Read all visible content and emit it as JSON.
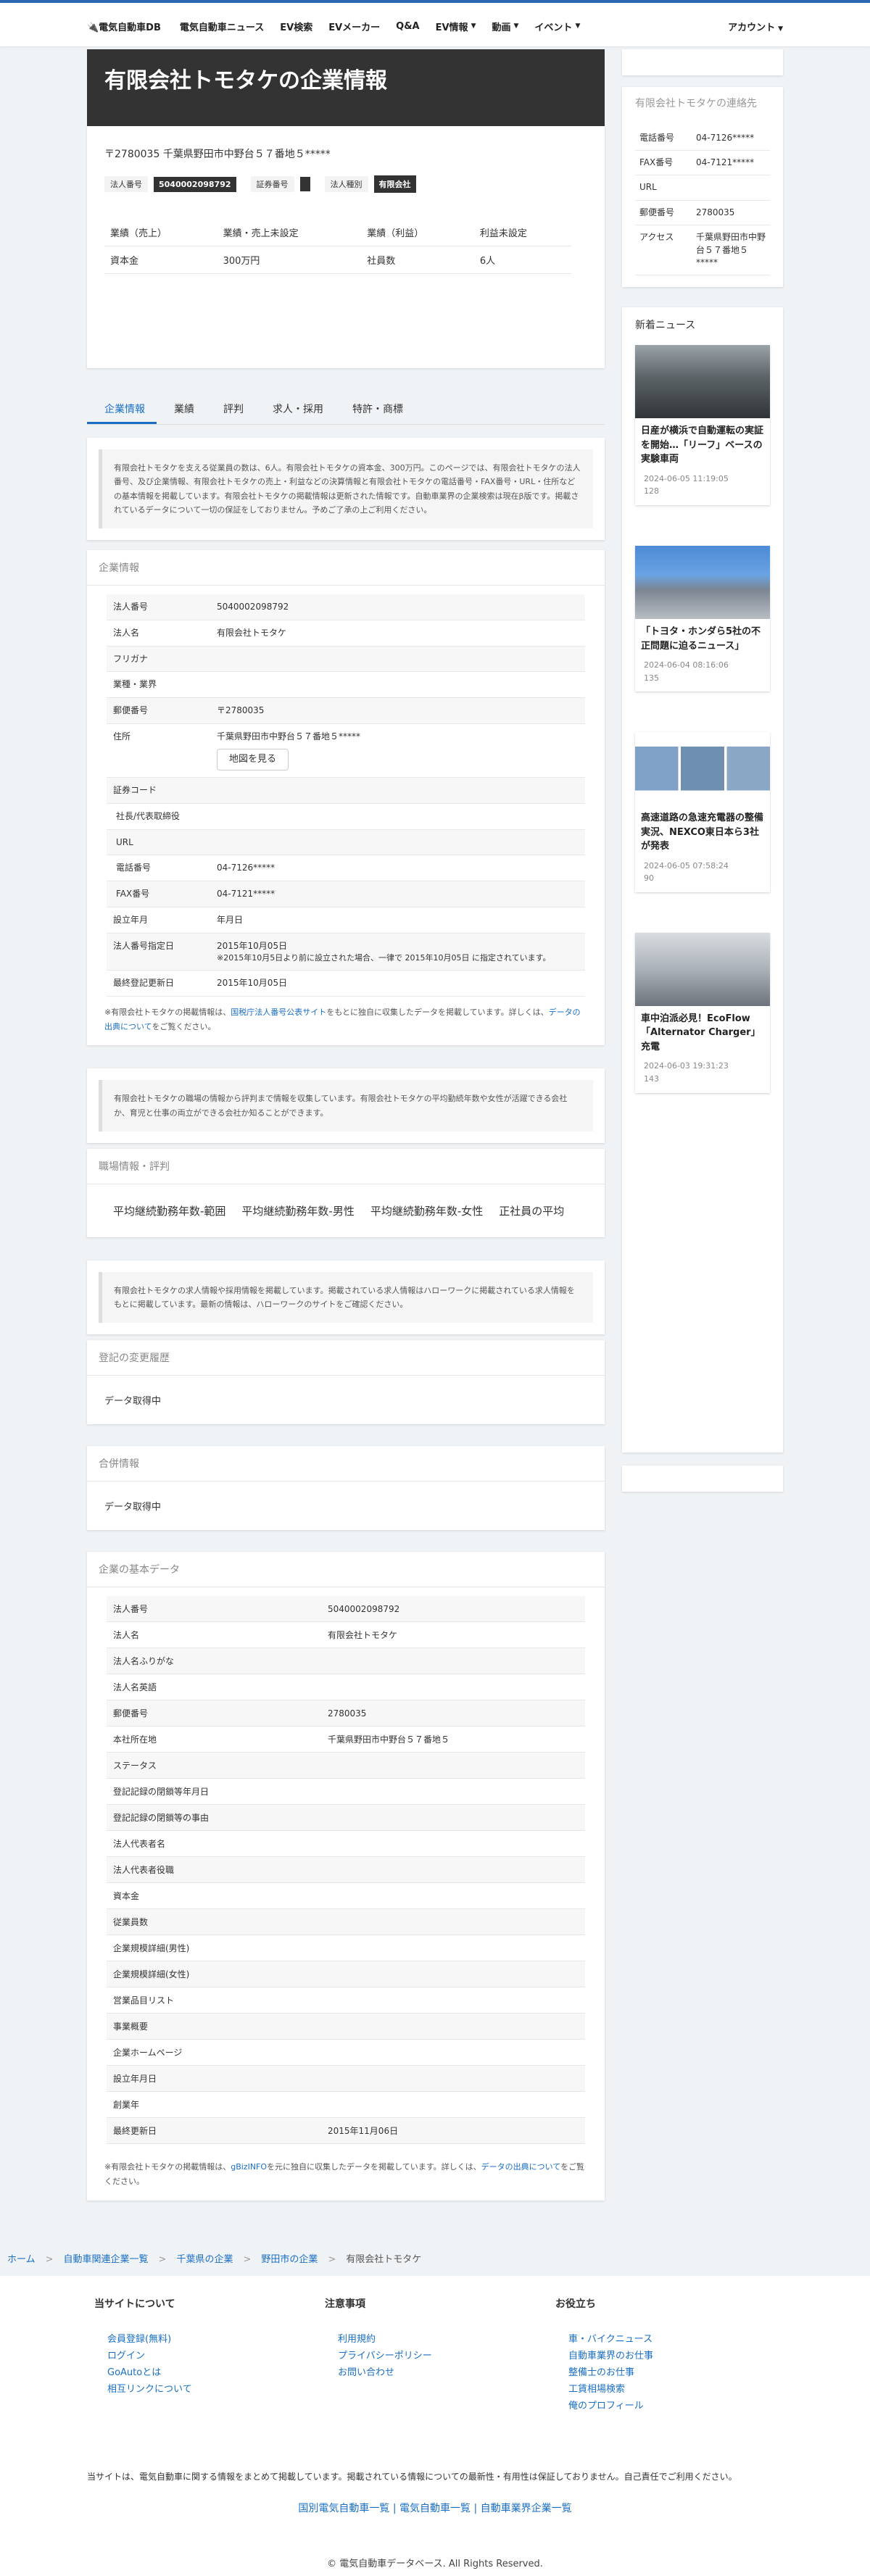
{
  "nav": {
    "logo": "🔌電気自動車DB",
    "items": [
      "電気自動車ニュース",
      "EV検索",
      "EVメーカー",
      "Q&A",
      "EV情報",
      "動画",
      "イベント"
    ],
    "dropdown_flags": [
      false,
      false,
      false,
      false,
      true,
      true,
      true
    ],
    "account": "アカウント"
  },
  "hero": {
    "title": "有限会社トモタケの企業情報"
  },
  "address": {
    "zip_line": "〒2780035",
    "addr": "千葉県野田市中野台５７番地５*****"
  },
  "badges": [
    {
      "label": "法人番号",
      "value": "5040002098792"
    },
    {
      "label": "証券番号",
      "value": ""
    },
    {
      "label": "法人種別",
      "value": "有限会社"
    }
  ],
  "summary": [
    [
      "業績（売上）",
      "業績・売上未設定",
      "業績（利益）",
      "利益未設定"
    ],
    [
      "資本金",
      "300万円",
      "社員数",
      "6人"
    ]
  ],
  "tabs": [
    "企業情報",
    "業績",
    "評判",
    "求人・採用",
    "特許・商標"
  ],
  "intro_note": "有限会社トモタケを支える従業員の数は、6人。有限会社トモタケの資本金、300万円。このページでは、有限会社トモタケの法人番号、及び企業情報、有限会社トモタケの売上・利益などの決算情報と有限会社トモタケの電話番号・FAX番号・URL・住所などの基本情報を掲載しています。有限会社トモタケの掲載情報は更新された情報です。自動車業界の企業検索は現在β版です。掲載されているデータについて一切の保証をしておりません。予めご了承の上ご利用ください。",
  "company_info": {
    "heading": "企業情報",
    "rows": [
      {
        "k": "法人番号",
        "v": "5040002098792"
      },
      {
        "k": "法人名",
        "v": "有限会社トモタケ"
      },
      {
        "k": "フリガナ",
        "v": ""
      },
      {
        "k": "業種・業界",
        "v": ""
      },
      {
        "k": "郵便番号",
        "v": "〒2780035"
      },
      {
        "k": "住所",
        "v": "千葉県野田市中野台５７番地５*****",
        "btn": "地図を見る"
      },
      {
        "k": "証券コード",
        "v": ""
      },
      {
        "k": "社長/代表取締役",
        "v": ""
      },
      {
        "k": "URL",
        "v": ""
      },
      {
        "k": "電話番号",
        "v": "04-7126*****"
      },
      {
        "k": "FAX番号",
        "v": "04-7121*****"
      },
      {
        "k": "設立年月",
        "v": "年月日"
      },
      {
        "k": "法人番号指定日",
        "v": "2015年10月05日",
        "sub": "※2015年10月5日より前に設立された場合、一律で 2015年10月05日 に指定されています。"
      },
      {
        "k": "最終登記更新日",
        "v": "2015年10月05日"
      }
    ],
    "source_pre": "※有限会社トモタケの掲載情報は、",
    "source_link": "国税庁法人番号公表サイト",
    "source_mid": "をもとに独自に収集したデータを掲載しています。詳しくは、",
    "source_link2": "データの出典について",
    "source_post": "をご覧ください。"
  },
  "workplace_note": "有限会社トモタケの職場の情報から評判まで情報を収集しています。有限会社トモタケの平均勤続年数や女性が活躍できる会社か、育児と仕事の両立ができる会社か知ることができます。",
  "workplace": {
    "heading": "職場情報・評判",
    "cols": [
      "平均継続勤務年数-範囲",
      "平均継続勤務年数-男性",
      "平均継続勤務年数-女性",
      "正社員の平均"
    ]
  },
  "jobs_note": "有限会社トモタケの求人情報や採用情報を掲載しています。掲載されている求人情報はハローワークに掲載されている求人情報をもとに掲載しています。最新の情報は、ハローワークのサイトをご確認ください。",
  "history": {
    "heading": "登記の変更履歴",
    "text": "データ取得中"
  },
  "merger": {
    "heading": "合併情報",
    "text": "データ取得中"
  },
  "basic": {
    "heading": "企業の基本データ",
    "rows": [
      {
        "k": "法人番号",
        "v": "5040002098792"
      },
      {
        "k": "法人名",
        "v": "有限会社トモタケ"
      },
      {
        "k": "法人名ふりがな",
        "v": ""
      },
      {
        "k": "法人名英語",
        "v": ""
      },
      {
        "k": "郵便番号",
        "v": "2780035"
      },
      {
        "k": "本社所在地",
        "v": "千葉県野田市中野台５７番地５"
      },
      {
        "k": "ステータス",
        "v": ""
      },
      {
        "k": "登記記録の閉鎖等年月日",
        "v": ""
      },
      {
        "k": "登記記録の閉鎖等の事由",
        "v": ""
      },
      {
        "k": "法人代表者名",
        "v": ""
      },
      {
        "k": "法人代表者役職",
        "v": ""
      },
      {
        "k": "資本金",
        "v": ""
      },
      {
        "k": "従業員数",
        "v": ""
      },
      {
        "k": "企業規模詳細(男性)",
        "v": ""
      },
      {
        "k": "企業規模詳細(女性)",
        "v": ""
      },
      {
        "k": "営業品目リスト",
        "v": ""
      },
      {
        "k": "事業概要",
        "v": ""
      },
      {
        "k": "企業ホームページ",
        "v": ""
      },
      {
        "k": "設立年月日",
        "v": ""
      },
      {
        "k": "創業年",
        "v": ""
      },
      {
        "k": "最終更新日",
        "v": "2015年11月06日"
      }
    ],
    "source_pre": "※有限会社トモタケの掲載情報は、",
    "source_link": "gBizINFO",
    "source_mid": "を元に独自に収集したデータを掲載しています。詳しくは、",
    "source_link2": "データの出典について",
    "source_post": "をご覧ください。"
  },
  "contact": {
    "title": "有限会社トモタケの連絡先",
    "rows": [
      {
        "k": "電話番号",
        "v": "04-7126*****"
      },
      {
        "k": "FAX番号",
        "v": "04-7121*****"
      },
      {
        "k": "URL",
        "v": ""
      },
      {
        "k": "郵便番号",
        "v": "2780035"
      },
      {
        "k": "アクセス",
        "v": "千葉県野田市中野台５７番地５*****"
      }
    ]
  },
  "news": {
    "title": "新着ニュース",
    "items": [
      {
        "title": "日産が横浜で自動運転の実証を開始…「リーフ」ベースの実験車両",
        "date": "2024-06-05 11:19:05",
        "views": "128"
      },
      {
        "title": "「トヨタ・ホンダら5社の不正問題に迫るニュース」",
        "date": "2024-06-04 08:16:06",
        "views": "135"
      },
      {
        "title": "高速道路の急速充電器の整備実況、NEXCO東日本ら3社が発表",
        "date": "2024-06-05 07:58:24",
        "views": "90"
      },
      {
        "title": "車中泊派必見！EcoFlow「Alternator Charger」充電",
        "date": "2024-06-03 19:31:23",
        "views": "143"
      }
    ]
  },
  "breadcrumb": [
    "ホーム",
    "自動車関連企業一覧",
    "千葉県の企業",
    "野田市の企業",
    "有限会社トモタケ"
  ],
  "footer": {
    "cols": [
      {
        "title": "当サイトについて",
        "links": [
          "会員登録(無料)",
          "ログイン",
          "GoAutoとは",
          "相互リンクについて"
        ]
      },
      {
        "title": "注意事項",
        "links": [
          "利用規約",
          "プライバシーポリシー",
          "お問い合わせ"
        ]
      },
      {
        "title": "お役立ち",
        "links": [
          "車・バイクニュース",
          "自動車業界のお仕事",
          "整備士のお仕事",
          "工賃相場検索",
          "俺のプロフィール"
        ]
      }
    ],
    "disclaimer": "当サイトは、電気自動車に関する情報をまとめて掲載しています。掲載されている情報についての最新性・有用性は保証しておりません。自己責任でご利用ください。",
    "links_line": "国別電気自動車一覧 | 電気自動車一覧 | 自動車業界企業一覧",
    "icons": "",
    "copyright": "© 電気自動車データベース. All Rights Reserved."
  }
}
